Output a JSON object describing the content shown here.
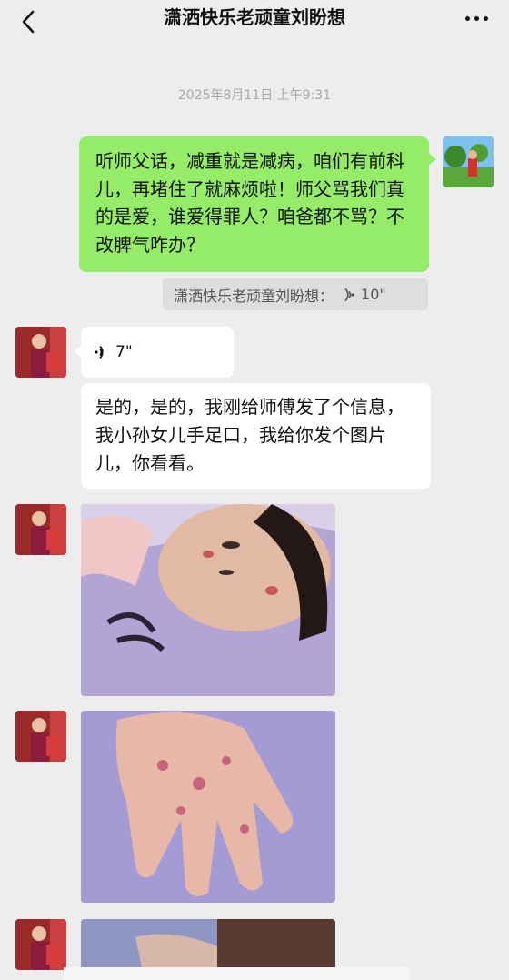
{
  "header": {
    "title": "潇洒快乐老顽童刘盼想",
    "back_icon": "chevron-left-icon",
    "more_icon": "more-dots-icon"
  },
  "chat": {
    "timestamp": "2025年8月11日 上午9:31",
    "messages": [
      {
        "side": "right",
        "text": "听师父话，减重就是减病，咱们有前科儿，再堵住了就麻烦啦！师父骂我们真的是爱，谁爱得罪人？咱爸都不骂？不改脾气咋办？",
        "quote": {
          "sender": "潇洒快乐老顽童刘盼想：",
          "duration": "10\""
        }
      },
      {
        "side": "left",
        "type": "voice",
        "duration": "7\""
      },
      {
        "side": "left",
        "type": "text",
        "text": "是的，是的，我刚给师傅发了个信息，我小孙女儿手足口，我给你发个图片儿，你看看。"
      }
    ]
  },
  "colors": {
    "background": "#ededed",
    "outgoing_bubble": "#95ec69",
    "incoming_bubble": "#ffffff",
    "quote_background": "#dedede",
    "timestamp_text": "#a8a8a8"
  }
}
